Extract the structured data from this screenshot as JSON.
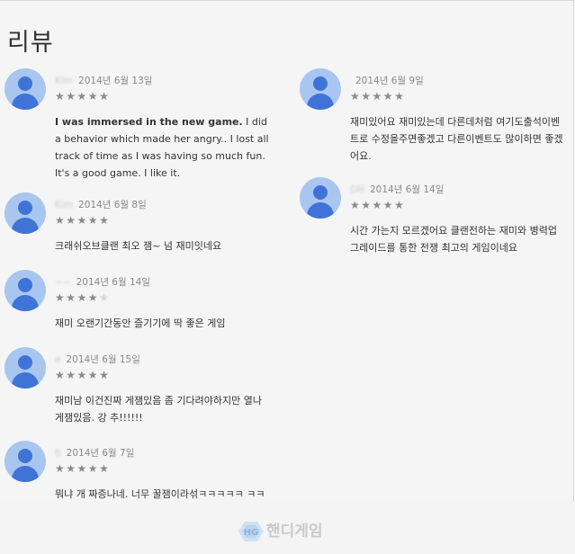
{
  "section_title": "리뷰",
  "colors": {
    "avatar_bg": "#a9c6f0",
    "avatar_fg": "#3f74d6",
    "star": "#8a8a8a"
  },
  "reviews_left": [
    {
      "name": "Kim",
      "date": "2014년 6월 13일",
      "stars": 5,
      "text_bold": "I was immersed in the new game.",
      "text": " I did a behavior which made her angry.. I lost all track of time as I was having so much fun. It's a good game. I like it."
    },
    {
      "name": "Kim",
      "date": "2014년 6월 8일",
      "stars": 5,
      "text_bold": "",
      "text": "크래쉬오브클랜 최오 잼~ 넘 재미잇네요"
    },
    {
      "name": "~~",
      "date": "2014년 6월 14일",
      "stars": 4,
      "text_bold": "",
      "text": "재미 오랜기간동안 즐기기에 딱 좋은 게임"
    },
    {
      "name": "e",
      "date": "2014년 6월 15일",
      "stars": 5,
      "text_bold": "",
      "text": "재미남 이건진짜 게잼있음 좀 기다려야하지만 열나게잼있음. 강 추!!!!!!"
    },
    {
      "name": "h",
      "date": "2014년 6월 7일",
      "stars": 5,
      "text_bold": "",
      "text": "뭐냐 개 짜증나네. 너무 꿀잼이라섞ㅋㅋㅋㅋㅋ ㅋㅋㅋㅋ"
    }
  ],
  "reviews_right": [
    {
      "name": "",
      "date": "2014년 6월 9일",
      "stars": 5,
      "text_bold": "",
      "text": "재미있어요 재미있는데 다른데처럼 여기도출석이벤트로 수정을주면좋겠고 다른이벤트도 많이하면 좋겠어요."
    },
    {
      "name": "DH",
      "date": "2014년 6월 14일",
      "stars": 5,
      "text_bold": "",
      "text": "시간 가는지 모르겠어요 클랜전하는 재미와 병력업그레이드를 통한 전쟁 최고의 게임이네요"
    }
  ],
  "watermark": "핸디게임"
}
